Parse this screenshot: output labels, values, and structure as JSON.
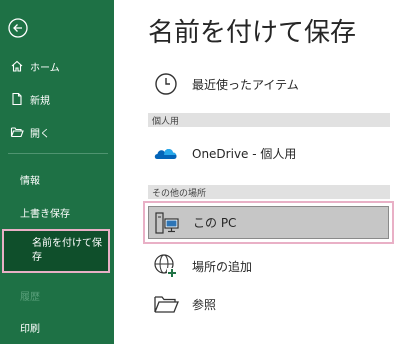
{
  "sidebar": {
    "back_icon": "back-arrow-icon",
    "items": [
      {
        "label": "ホーム",
        "icon": "home-icon"
      },
      {
        "label": "新規",
        "icon": "new-document-icon"
      },
      {
        "label": "開く",
        "icon": "open-folder-icon"
      },
      {
        "label": "情報"
      },
      {
        "label": "上書き保存"
      },
      {
        "label": "名前を付けて保存"
      },
      {
        "label": "履歴"
      },
      {
        "label": "印刷"
      }
    ],
    "selected_label_line1": "名前を付けて保",
    "selected_label_line2": "存"
  },
  "main": {
    "title": "名前を付けて保存",
    "recent": {
      "label": "最近使ったアイテム",
      "icon": "clock-icon"
    },
    "sections": [
      {
        "header": "個人用"
      },
      {
        "header": "その他の場所"
      }
    ],
    "onedrive": {
      "label": "OneDrive - 個人用",
      "icon": "onedrive-cloud-icon"
    },
    "this_pc": {
      "label": "この PC",
      "icon": "computer-icon"
    },
    "add_place": {
      "label": "場所の追加",
      "icon": "globe-plus-icon"
    },
    "browse": {
      "label": "参照",
      "icon": "folder-icon"
    }
  },
  "colors": {
    "sidebar_bg": "#1e7145",
    "selected_bg": "#0f4f2b",
    "highlight_border": "#e9b0c6",
    "onedrive_blue": "#0364b8"
  }
}
